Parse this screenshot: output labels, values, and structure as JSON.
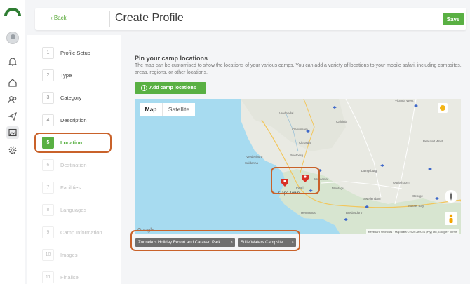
{
  "header": {
    "back_label": "Back",
    "title": "Create Profile",
    "save_label": "Save"
  },
  "steps": [
    {
      "num": "1",
      "label": "Profile Setup",
      "state": "done"
    },
    {
      "num": "2",
      "label": "Type",
      "state": "done"
    },
    {
      "num": "3",
      "label": "Category",
      "state": "done"
    },
    {
      "num": "4",
      "label": "Description",
      "state": "done"
    },
    {
      "num": "5",
      "label": "Location",
      "state": "active"
    },
    {
      "num": "6",
      "label": "Destination",
      "state": "pending"
    },
    {
      "num": "7",
      "label": "Facilities",
      "state": "pending"
    },
    {
      "num": "8",
      "label": "Languages",
      "state": "pending"
    },
    {
      "num": "9",
      "label": "Camp Information",
      "state": "pending"
    },
    {
      "num": "10",
      "label": "Images",
      "state": "pending"
    },
    {
      "num": "11",
      "label": "Finalise",
      "state": "pending"
    }
  ],
  "content": {
    "heading": "Pin your camp locations",
    "description": "The map can be customised to show the locations of your various camps. You can add a variety of locations to your mobile safari, including campsites, areas, regions, or other locations.",
    "add_button_label": "Add camp locations"
  },
  "map": {
    "type_options": [
      "Map",
      "Satellite"
    ],
    "selected_type": "Map",
    "place_labels": [
      "Victoria West",
      "Clanwilliam",
      "Vredendal",
      "Citrusdal",
      "Piketberg",
      "Vredenburg",
      "Saldanha",
      "Paarl",
      "Worcester",
      "Cape Town",
      "Montagu",
      "Swellendam",
      "George",
      "Oudtshoorn",
      "Beaufort West",
      "Calvinia",
      "Mossel Bay",
      "Hermanus",
      "Bredasdorp",
      "Laingsburg"
    ],
    "attribution": [
      "Keyboard shortcuts",
      "Map data ©2026 AfriGIS (Pty) Ltd, Google",
      "Terms"
    ],
    "google_label": "Google"
  },
  "selected_locations": [
    "Zonnekus Holiday Resort and Caravan Park",
    "Stille Waters Campsite"
  ],
  "colors": {
    "accent": "#59b043",
    "highlight": "#c9622a",
    "marker": "#d93025"
  },
  "icons": [
    "logo-icon",
    "bell-icon",
    "home-icon",
    "users-icon",
    "send-icon",
    "image-icon",
    "gear-icon",
    "fullscreen-icon",
    "pegman-icon",
    "compass-icon"
  ]
}
